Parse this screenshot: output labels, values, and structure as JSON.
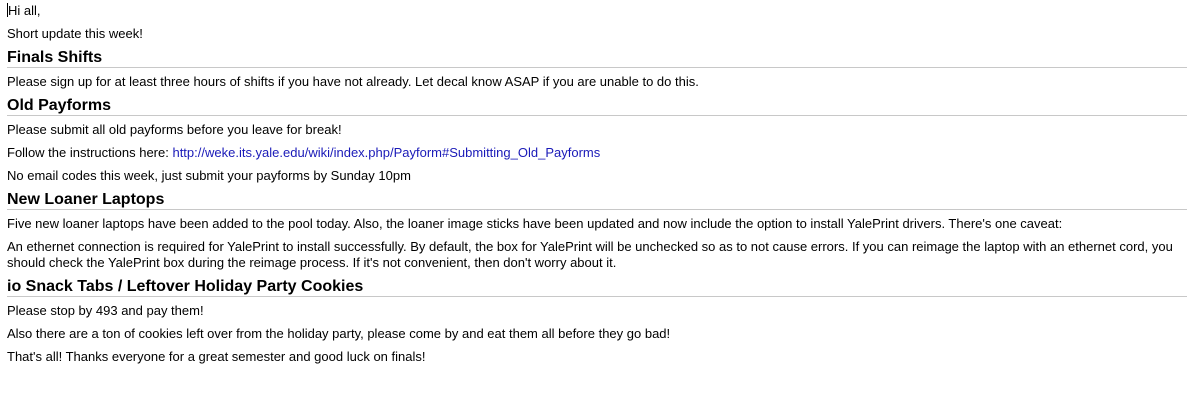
{
  "greeting": "Hi all,",
  "intro": "Short update this week!",
  "sections": [
    {
      "heading": "Finals Shifts",
      "paragraphs": [
        "Please sign up for at least three hours of shifts if you have not already. Let decal know ASAP if you are unable to do this."
      ]
    },
    {
      "heading": "Old Payforms",
      "p1": "Please submit all old payforms before you leave for break!",
      "p2_prefix": "Follow the instructions here: ",
      "p2_link": "http://weke.its.yale.edu/wiki/index.php/Payform#Submitting_Old_Payforms",
      "p3": "No email codes this week, just submit your payforms by Sunday 10pm"
    },
    {
      "heading": "New Loaner Laptops",
      "paragraphs": [
        "Five new loaner laptops have been added to the pool today. Also, the loaner image sticks have been updated and now include the option to install YalePrint drivers. There's one caveat:",
        "An ethernet connection is required for YalePrint to install successfully. By default, the box for YalePrint will be unchecked so as to not cause errors. If you can reimage the laptop with an ethernet cord, you should check the YalePrint box during the reimage process. If it's not convenient, then don't worry about it."
      ]
    },
    {
      "heading": "io Snack Tabs / Leftover Holiday Party Cookies",
      "paragraphs": [
        "Please stop by 493 and pay them!",
        "Also there are a ton of cookies left over from the holiday party, please come by and eat them all before they go bad!"
      ]
    }
  ],
  "closing": "That's all! Thanks everyone for a great semester and good luck on finals!"
}
